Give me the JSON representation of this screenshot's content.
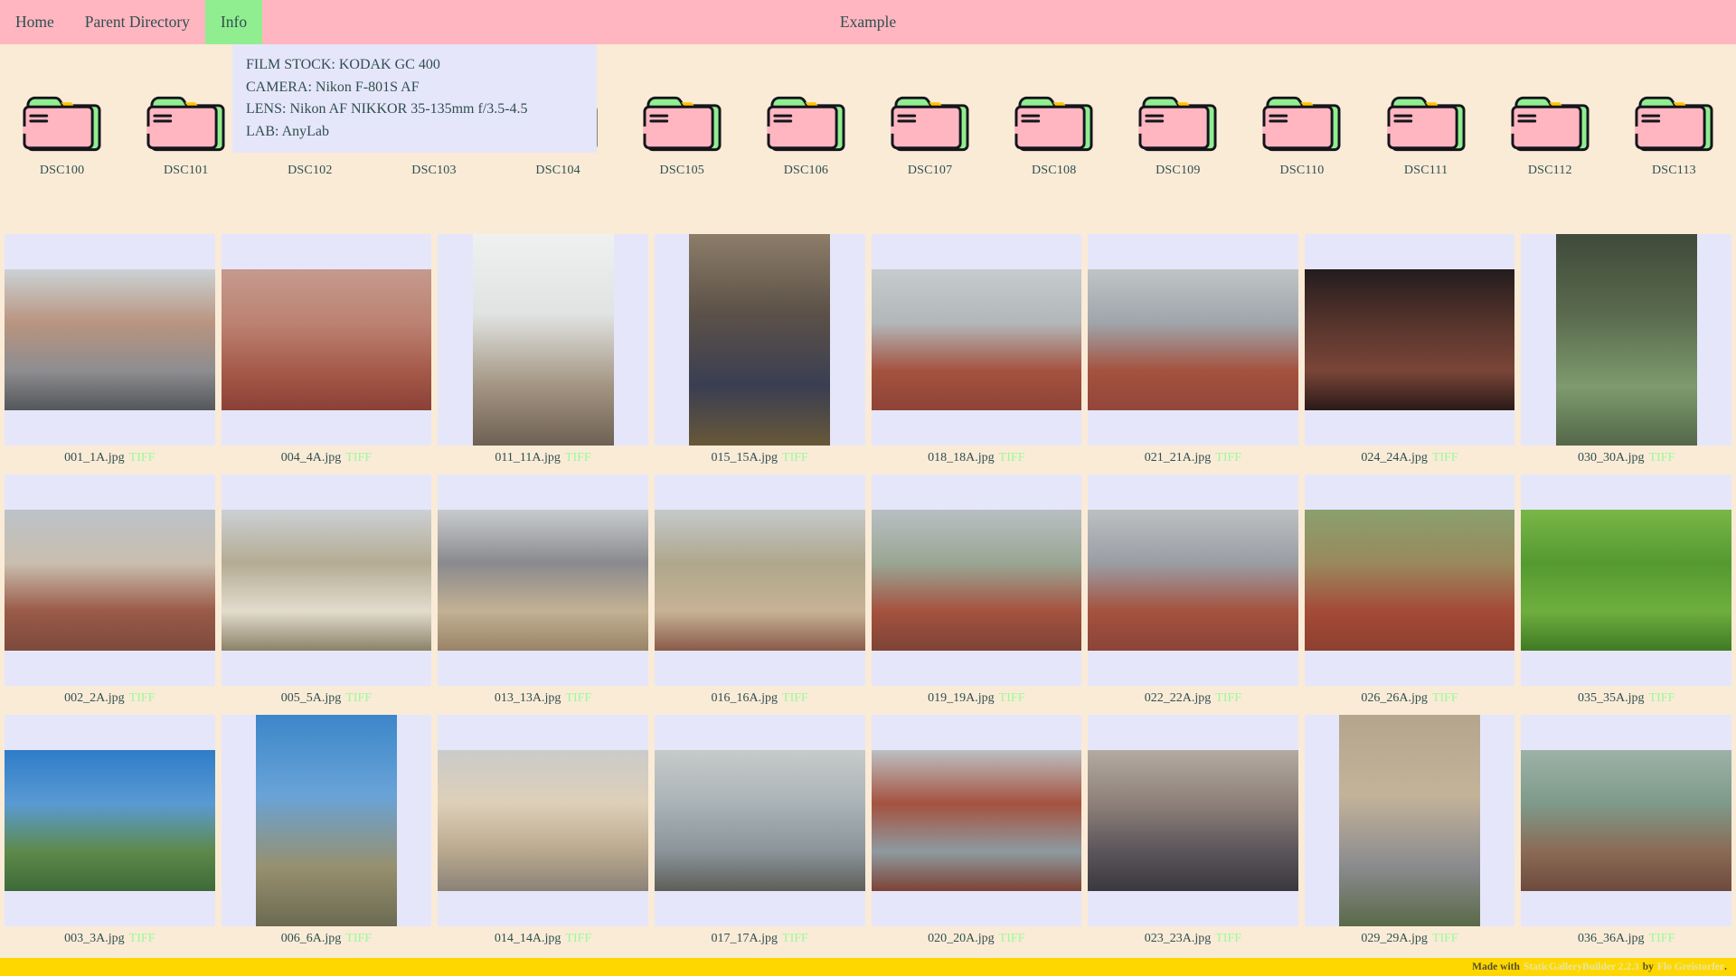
{
  "nav": {
    "title": "Example",
    "items": [
      {
        "label": "Home",
        "active": false
      },
      {
        "label": "Parent Directory",
        "active": false
      },
      {
        "label": "Info",
        "active": true
      }
    ]
  },
  "info_popup": {
    "lines": [
      "FILM STOCK: KODAK GC 400",
      "CAMERA: Nikon F-801S AF",
      "LENS: Nikon AF NIKKOR 35-135mm f/3.5-4.5",
      "LAB: AnyLab"
    ]
  },
  "folders": [
    "DSC100",
    "DSC101",
    "DSC102",
    "DSC103",
    "DSC104",
    "DSC105",
    "DSC106",
    "DSC107",
    "DSC108",
    "DSC109",
    "DSC110",
    "DSC111",
    "DSC112",
    "DSC113"
  ],
  "gallery": {
    "tag_label": "TIFF",
    "rows": [
      [
        {
          "file": "001_1A.jpg",
          "orient": "l",
          "colors": [
            "#ccd2d5",
            "#b99480",
            "#8d8d90",
            "#54565a"
          ]
        },
        {
          "file": "004_4A.jpg",
          "orient": "l",
          "colors": [
            "#c59a8e",
            "#bc8272",
            "#a55a49",
            "#8a4037"
          ]
        },
        {
          "file": "011_11A.jpg",
          "orient": "p",
          "colors": [
            "#eff1f0",
            "#e0e3e1",
            "#a39482",
            "#6e6053"
          ]
        },
        {
          "file": "015_15A.jpg",
          "orient": "p",
          "colors": [
            "#8d7d69",
            "#5b5148",
            "#3a3e52",
            "#685838"
          ]
        },
        {
          "file": "018_18A.jpg",
          "orient": "l",
          "colors": [
            "#c6cbcd",
            "#b2b7b9",
            "#a5523f",
            "#8d4336"
          ]
        },
        {
          "file": "021_21A.jpg",
          "orient": "l",
          "colors": [
            "#c0c4c4",
            "#9fa5ab",
            "#a5523f",
            "#92463a"
          ]
        },
        {
          "file": "024_24A.jpg",
          "orient": "l",
          "colors": [
            "#241c1e",
            "#56342c",
            "#7a4538",
            "#2a1a18"
          ]
        },
        {
          "file": "030_30A.jpg",
          "orient": "p",
          "colors": [
            "#3f4a3a",
            "#5a6a4e",
            "#7e9a6e",
            "#546849"
          ]
        }
      ],
      [
        {
          "file": "002_2A.jpg",
          "orient": "l",
          "colors": [
            "#bcc2c8",
            "#c9beae",
            "#9a5a48",
            "#7d4a3c"
          ]
        },
        {
          "file": "005_5A.jpg",
          "orient": "l",
          "colors": [
            "#ccd0d4",
            "#b4ac93",
            "#e3dccd",
            "#8a8268"
          ]
        },
        {
          "file": "013_13A.jpg",
          "orient": "l",
          "colors": [
            "#c8cbce",
            "#8a8a8e",
            "#c3b193",
            "#998367"
          ]
        },
        {
          "file": "016_16A.jpg",
          "orient": "l",
          "colors": [
            "#c5c9cb",
            "#afa78d",
            "#c7b294",
            "#8a5a48"
          ]
        },
        {
          "file": "019_19A.jpg",
          "orient": "l",
          "colors": [
            "#b8bfc2",
            "#9aa694",
            "#a5523f",
            "#7d4336"
          ]
        },
        {
          "file": "022_22A.jpg",
          "orient": "l",
          "colors": [
            "#bcc0c0",
            "#9a9ea4",
            "#a5523f",
            "#8a4438"
          ]
        },
        {
          "file": "026_26A.jpg",
          "orient": "l",
          "colors": [
            "#8ba06e",
            "#99895d",
            "#a54a38",
            "#8d402f"
          ]
        },
        {
          "file": "035_35A.jpg",
          "orient": "l",
          "colors": [
            "#7ab648",
            "#549a30",
            "#6fae3e",
            "#3f7a24"
          ]
        }
      ],
      [
        {
          "file": "003_3A.jpg",
          "orient": "l",
          "colors": [
            "#2e7cc8",
            "#5a9ad4",
            "#5d8a4a",
            "#3e6a38"
          ]
        },
        {
          "file": "006_6A.jpg",
          "orient": "p",
          "colors": [
            "#3c86c9",
            "#69a3d7",
            "#97906e",
            "#6b6a52"
          ]
        },
        {
          "file": "014_14A.jpg",
          "orient": "l",
          "colors": [
            "#cbcbca",
            "#ddd0b8",
            "#b9a88e",
            "#8a8278"
          ]
        },
        {
          "file": "017_17A.jpg",
          "orient": "l",
          "colors": [
            "#c6caca",
            "#aab4b6",
            "#8a949a",
            "#5e5e58"
          ]
        },
        {
          "file": "020_20A.jpg",
          "orient": "l",
          "colors": [
            "#bcc0c2",
            "#a5523f",
            "#8e9aa0",
            "#7d4336"
          ]
        },
        {
          "file": "023_23A.jpg",
          "orient": "l",
          "colors": [
            "#b3aaa2",
            "#8e8078",
            "#5a555a",
            "#3a383e"
          ]
        },
        {
          "file": "029_29A.jpg",
          "orient": "p",
          "colors": [
            "#b5a58e",
            "#c3b399",
            "#8a8a8e",
            "#5a6a48"
          ]
        },
        {
          "file": "036_36A.jpg",
          "orient": "l",
          "colors": [
            "#9cb2a8",
            "#7e9a8a",
            "#8a6a55",
            "#6e4a3e"
          ]
        }
      ]
    ]
  },
  "footer": {
    "made_with": "Made with",
    "builder_link": "StaticGalleryBuilder 2.2.3",
    "by": "by",
    "author_link": "Flo Greistorfer",
    "period": "."
  },
  "colors": {
    "nav_bg": "#ffb6c1",
    "active_bg": "#90ee90",
    "page_bg": "#faebd7",
    "cell_bg": "#e6e6fa",
    "popup_bg": "#e6e6fa",
    "text": "#2f4f4f",
    "tag": "#98fb98",
    "footer_bg": "#ffd700",
    "footer_link": "#e6e79e",
    "folder_pink": "#ffb6c1",
    "folder_green": "#90ee90",
    "folder_accent": "#ffc400"
  }
}
